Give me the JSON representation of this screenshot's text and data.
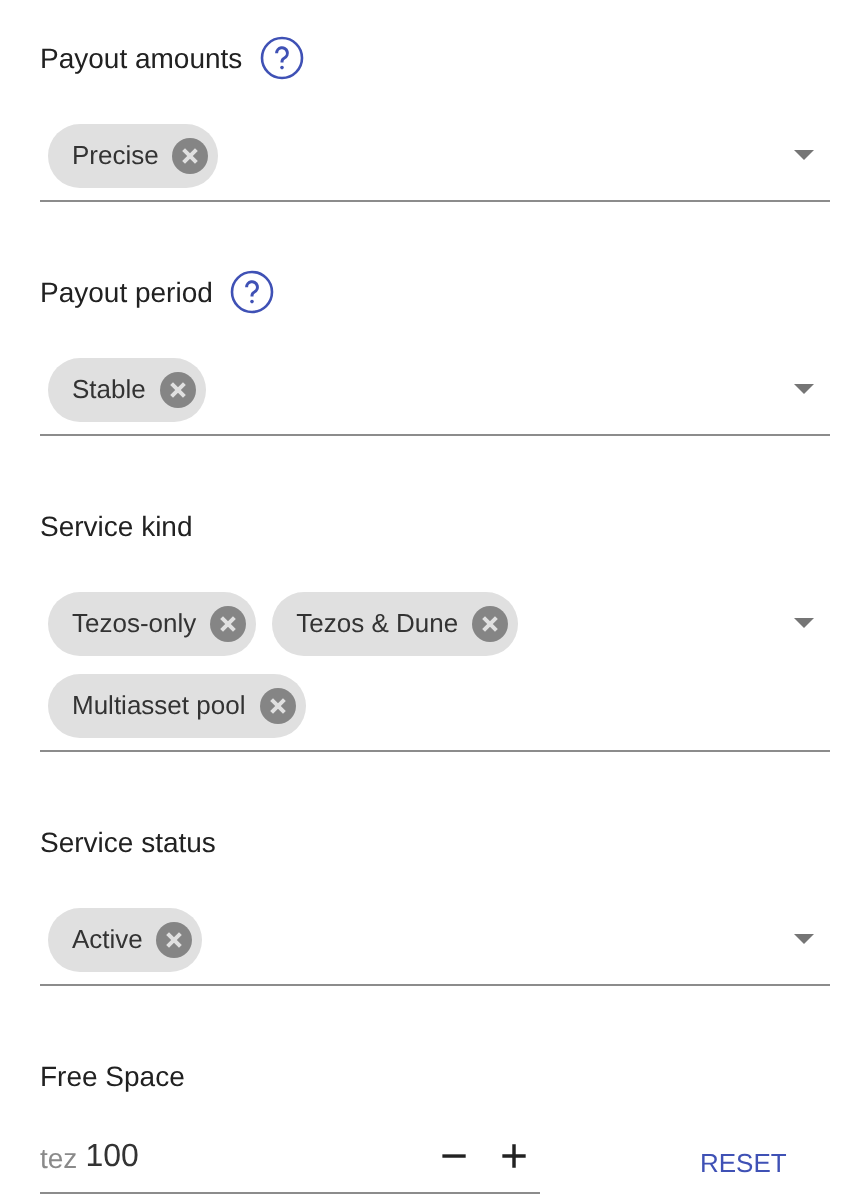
{
  "sections": [
    {
      "kind": "select",
      "title": "Payout amounts",
      "help": true,
      "chips": [
        "Precise"
      ]
    },
    {
      "kind": "select",
      "title": "Payout period",
      "help": true,
      "chips": [
        "Stable"
      ]
    },
    {
      "kind": "select",
      "title": "Service kind",
      "help": false,
      "chips": [
        "Tezos-only",
        "Tezos & Dune",
        "Multiasset pool"
      ]
    },
    {
      "kind": "select",
      "title": "Service status",
      "help": false,
      "chips": [
        "Active"
      ]
    },
    {
      "kind": "number",
      "title": "Free Space",
      "help": false,
      "prefix": "tez",
      "value": "100",
      "minus": "−",
      "plus": "+",
      "reset": "RESET"
    }
  ]
}
